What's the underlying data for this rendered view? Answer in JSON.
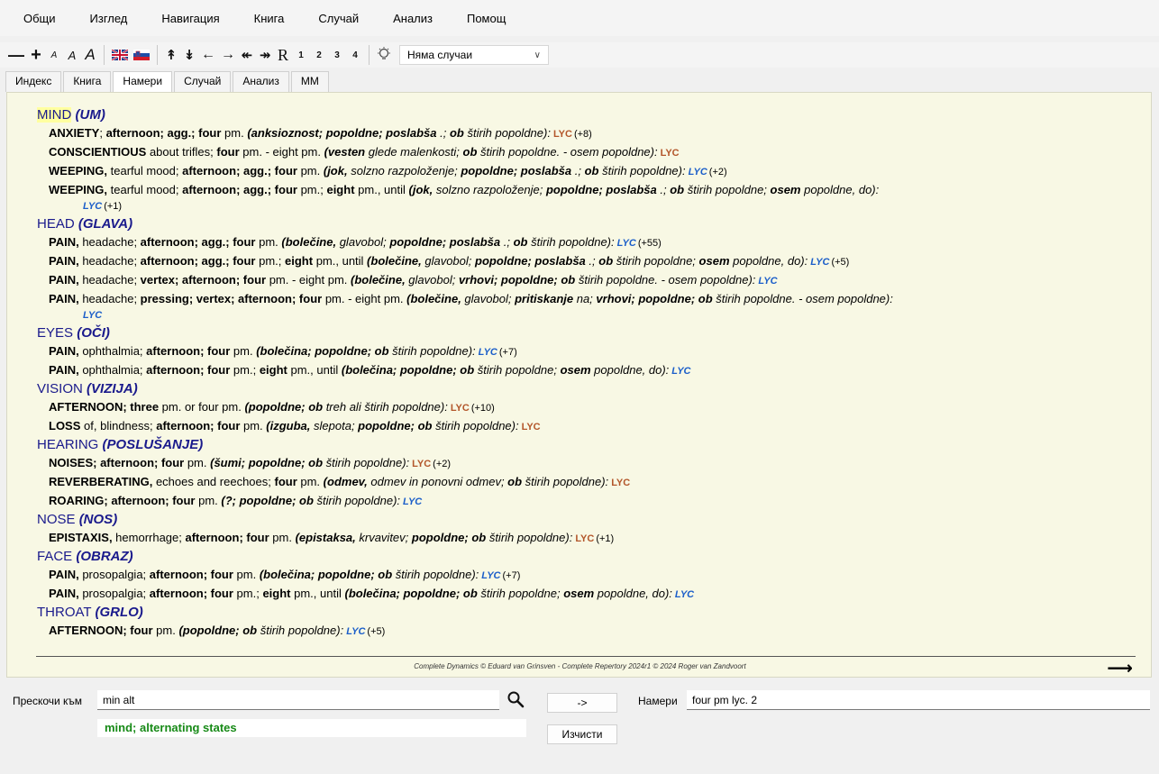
{
  "menu": [
    "Общи",
    "Изглед",
    "Навигация",
    "Книга",
    "Случай",
    "Анализ",
    "Помощ"
  ],
  "toolbar": {
    "font_small": "A",
    "font_medium": "A",
    "font_large": "A",
    "r_label": "R",
    "levels": [
      "1",
      "2",
      "3",
      "4"
    ],
    "case_select": "Няма случаи"
  },
  "tabs": [
    "Индекс",
    "Книга",
    "Намери",
    "Случай",
    "Анализ",
    "ММ"
  ],
  "active_tab": "Намери",
  "repertory": {
    "chapters": [
      {
        "name": "MIND",
        "tr": "(UM)",
        "rubrics": [
          {
            "parts": [
              [
                "b",
                "ANXIETY"
              ],
              [
                "n",
                "; "
              ],
              [
                "b",
                "afternoon; agg.; four"
              ],
              [
                "n",
                " pm. "
              ],
              [
                "bi",
                "(anksioznost; popoldne; poslabša"
              ],
              [
                "i",
                " .; "
              ],
              [
                "bi",
                "ob"
              ],
              [
                "i",
                " štirih popoldne):"
              ]
            ],
            "lyc": "LYC",
            "lyc_color": "orange",
            "count": "(+8)"
          },
          {
            "parts": [
              [
                "b",
                "CONSCIENTIOUS"
              ],
              [
                "n",
                " about trifles; "
              ],
              [
                "b",
                "four"
              ],
              [
                "n",
                " pm. - eight pm. "
              ],
              [
                "bi",
                "(vesten"
              ],
              [
                "i",
                " glede malenkosti; "
              ],
              [
                "bi",
                "ob"
              ],
              [
                "i",
                " štirih popoldne. - osem popoldne):"
              ]
            ],
            "lyc": "LYC",
            "lyc_color": "orange",
            "count": ""
          },
          {
            "parts": [
              [
                "b",
                "WEEPING,"
              ],
              [
                "n",
                " tearful mood; "
              ],
              [
                "b",
                "afternoon; agg.; four"
              ],
              [
                "n",
                " pm. "
              ],
              [
                "bi",
                "(jok,"
              ],
              [
                "i",
                " solzno razpoloženje; "
              ],
              [
                "bi",
                "popoldne; poslabša"
              ],
              [
                "i",
                " .; "
              ],
              [
                "bi",
                "ob"
              ],
              [
                "i",
                " štirih popoldne):"
              ]
            ],
            "lyc": "LYC",
            "lyc_color": "blue",
            "count": "(+2)"
          },
          {
            "parts": [
              [
                "b",
                "WEEPING,"
              ],
              [
                "n",
                " tearful mood; "
              ],
              [
                "b",
                "afternoon; agg.; four"
              ],
              [
                "n",
                " pm.; "
              ],
              [
                "b",
                "eight"
              ],
              [
                "n",
                " pm., until "
              ],
              [
                "bi",
                "(jok,"
              ],
              [
                "i",
                " solzno razpoloženje; "
              ],
              [
                "bi",
                "popoldne; poslabša"
              ],
              [
                "i",
                " .; "
              ],
              [
                "bi",
                "ob"
              ],
              [
                "i",
                " štirih popoldne; "
              ],
              [
                "bi",
                "osem"
              ],
              [
                "i",
                " popoldne, do):"
              ]
            ],
            "lyc": "LYC",
            "lyc_color": "blue",
            "count": "(+1)",
            "wrap": true
          }
        ]
      },
      {
        "name": "HEAD",
        "tr": "(GLAVA)",
        "rubrics": [
          {
            "parts": [
              [
                "b",
                "PAIN,"
              ],
              [
                "n",
                " headache; "
              ],
              [
                "b",
                "afternoon; agg.; four"
              ],
              [
                "n",
                " pm. "
              ],
              [
                "bi",
                "(bolečine,"
              ],
              [
                "i",
                " glavobol; "
              ],
              [
                "bi",
                "popoldne; poslabša"
              ],
              [
                "i",
                " .; "
              ],
              [
                "bi",
                "ob"
              ],
              [
                "i",
                " štirih popoldne):"
              ]
            ],
            "lyc": "LYC",
            "lyc_color": "blue",
            "count": "(+55)"
          },
          {
            "parts": [
              [
                "b",
                "PAIN,"
              ],
              [
                "n",
                " headache; "
              ],
              [
                "b",
                "afternoon; agg.; four"
              ],
              [
                "n",
                " pm.; "
              ],
              [
                "b",
                "eight"
              ],
              [
                "n",
                " pm., until "
              ],
              [
                "bi",
                "(bolečine,"
              ],
              [
                "i",
                " glavobol; "
              ],
              [
                "bi",
                "popoldne; poslabša"
              ],
              [
                "i",
                " .; "
              ],
              [
                "bi",
                "ob"
              ],
              [
                "i",
                " štirih popoldne; "
              ],
              [
                "bi",
                "osem"
              ],
              [
                "i",
                " popoldne, do):"
              ]
            ],
            "lyc": "LYC",
            "lyc_color": "blue",
            "count": "(+5)"
          },
          {
            "parts": [
              [
                "b",
                "PAIN,"
              ],
              [
                "n",
                " headache; "
              ],
              [
                "b",
                "vertex; afternoon; four"
              ],
              [
                "n",
                " pm. - eight pm. "
              ],
              [
                "bi",
                "(bolečine,"
              ],
              [
                "i",
                " glavobol; "
              ],
              [
                "bi",
                "vrhovi; popoldne; ob"
              ],
              [
                "i",
                " štirih popoldne. - osem popoldne):"
              ]
            ],
            "lyc": "LYC",
            "lyc_color": "blue",
            "count": ""
          },
          {
            "parts": [
              [
                "b",
                "PAIN,"
              ],
              [
                "n",
                " headache; "
              ],
              [
                "b",
                "pressing; vertex; afternoon; four"
              ],
              [
                "n",
                " pm. - eight pm. "
              ],
              [
                "bi",
                "(bolečine,"
              ],
              [
                "i",
                " glavobol; "
              ],
              [
                "bi",
                "pritiskanje"
              ],
              [
                "i",
                " na; "
              ],
              [
                "bi",
                "vrhovi; popoldne; ob"
              ],
              [
                "i",
                " štirih popoldne. - osem popoldne):"
              ]
            ],
            "lyc": "LYC",
            "lyc_color": "blue",
            "count": "",
            "wrap": true
          }
        ]
      },
      {
        "name": "EYES",
        "tr": "(OČI)",
        "rubrics": [
          {
            "parts": [
              [
                "b",
                "PAIN,"
              ],
              [
                "n",
                " ophthalmia; "
              ],
              [
                "b",
                "afternoon; four"
              ],
              [
                "n",
                " pm. "
              ],
              [
                "bi",
                "(bolečina; popoldne; ob"
              ],
              [
                "i",
                " štirih popoldne):"
              ]
            ],
            "lyc": "LYC",
            "lyc_color": "blue",
            "count": "(+7)"
          },
          {
            "parts": [
              [
                "b",
                "PAIN,"
              ],
              [
                "n",
                " ophthalmia; "
              ],
              [
                "b",
                "afternoon; four"
              ],
              [
                "n",
                " pm.; "
              ],
              [
                "b",
                "eight"
              ],
              [
                "n",
                " pm., until "
              ],
              [
                "bi",
                "(bolečina; popoldne; ob"
              ],
              [
                "i",
                " štirih popoldne; "
              ],
              [
                "bi",
                "osem"
              ],
              [
                "i",
                " popoldne, do):"
              ]
            ],
            "lyc": "LYC",
            "lyc_color": "blue",
            "count": ""
          }
        ]
      },
      {
        "name": "VISION",
        "tr": "(VIZIJA)",
        "rubrics": [
          {
            "parts": [
              [
                "b",
                "AFTERNOON; three"
              ],
              [
                "n",
                " pm. or four pm. "
              ],
              [
                "bi",
                "(popoldne; ob"
              ],
              [
                "i",
                " treh ali štirih popoldne):"
              ]
            ],
            "lyc": "LYC",
            "lyc_color": "orange",
            "count": "(+10)"
          },
          {
            "parts": [
              [
                "b",
                "LOSS"
              ],
              [
                "n",
                " of, blindness; "
              ],
              [
                "b",
                "afternoon; four"
              ],
              [
                "n",
                " pm. "
              ],
              [
                "bi",
                "(izguba,"
              ],
              [
                "i",
                " slepota; "
              ],
              [
                "bi",
                "popoldne; ob"
              ],
              [
                "i",
                " štirih popoldne):"
              ]
            ],
            "lyc": "LYC",
            "lyc_color": "orange",
            "count": ""
          }
        ]
      },
      {
        "name": "HEARING",
        "tr": "(POSLUŠANJE)",
        "rubrics": [
          {
            "parts": [
              [
                "b",
                "NOISES; afternoon; four"
              ],
              [
                "n",
                " pm. "
              ],
              [
                "bi",
                "(šumi; popoldne; ob"
              ],
              [
                "i",
                " štirih popoldne):"
              ]
            ],
            "lyc": "LYC",
            "lyc_color": "orange",
            "count": "(+2)"
          },
          {
            "parts": [
              [
                "b",
                "REVERBERATING,"
              ],
              [
                "n",
                " echoes and reechoes; "
              ],
              [
                "b",
                "four"
              ],
              [
                "n",
                " pm. "
              ],
              [
                "bi",
                "(odmev,"
              ],
              [
                "i",
                " odmev in ponovni odmev; "
              ],
              [
                "bi",
                "ob"
              ],
              [
                "i",
                " štirih popoldne):"
              ]
            ],
            "lyc": "LYC",
            "lyc_color": "orange",
            "count": ""
          },
          {
            "parts": [
              [
                "b",
                "ROARING; afternoon; four"
              ],
              [
                "n",
                " pm. "
              ],
              [
                "bi",
                "(?; popoldne; ob"
              ],
              [
                "i",
                " štirih popoldne):"
              ]
            ],
            "lyc": "LYC",
            "lyc_color": "blue",
            "count": ""
          }
        ]
      },
      {
        "name": "NOSE",
        "tr": "(NOS)",
        "rubrics": [
          {
            "parts": [
              [
                "b",
                "EPISTAXIS,"
              ],
              [
                "n",
                " hemorrhage; "
              ],
              [
                "b",
                "afternoon; four"
              ],
              [
                "n",
                " pm. "
              ],
              [
                "bi",
                "(epistaksa,"
              ],
              [
                "i",
                " krvavitev; "
              ],
              [
                "bi",
                "popoldne; ob"
              ],
              [
                "i",
                " štirih popoldne):"
              ]
            ],
            "lyc": "LYC",
            "lyc_color": "orange",
            "count": "(+1)"
          }
        ]
      },
      {
        "name": "FACE",
        "tr": "(OBRAZ)",
        "rubrics": [
          {
            "parts": [
              [
                "b",
                "PAIN,"
              ],
              [
                "n",
                " prosopalgia; "
              ],
              [
                "b",
                "afternoon; four"
              ],
              [
                "n",
                " pm. "
              ],
              [
                "bi",
                "(bolečina; popoldne; ob"
              ],
              [
                "i",
                " štirih popoldne):"
              ]
            ],
            "lyc": "LYC",
            "lyc_color": "blue",
            "count": "(+7)"
          },
          {
            "parts": [
              [
                "b",
                "PAIN,"
              ],
              [
                "n",
                " prosopalgia; "
              ],
              [
                "b",
                "afternoon; four"
              ],
              [
                "n",
                " pm.; "
              ],
              [
                "b",
                "eight"
              ],
              [
                "n",
                " pm., until "
              ],
              [
                "bi",
                "(bolečina; popoldne; ob"
              ],
              [
                "i",
                " štirih popoldne; "
              ],
              [
                "bi",
                "osem"
              ],
              [
                "i",
                " popoldne, do):"
              ]
            ],
            "lyc": "LYC",
            "lyc_color": "blue",
            "count": ""
          }
        ]
      },
      {
        "name": "THROAT",
        "tr": "(GRLO)",
        "rubrics": [
          {
            "parts": [
              [
                "b",
                "AFTERNOON; four"
              ],
              [
                "n",
                " pm. "
              ],
              [
                "bi",
                "(popoldne; ob"
              ],
              [
                "i",
                " štirih popoldne):"
              ]
            ],
            "lyc": "LYC",
            "lyc_color": "blue",
            "count": "(+5)"
          }
        ]
      }
    ],
    "copyright": "Complete Dynamics © Eduard van Grinsven  -  Complete Repertory 2024r1 © 2024 Roger van Zandvoort"
  },
  "bottom": {
    "jump_label": "Прескочи към",
    "jump_value": "min alt",
    "suggestion": "mind; alternating states",
    "go_button": "->",
    "find_label": "Намери",
    "find_value": "four pm lyc. 2",
    "clear_button": "Изчисти"
  },
  "colors": {
    "content_bg": "#f8f8e4",
    "chapter": "#1a1a8c",
    "lyc_orange": "#b3562a",
    "lyc_blue": "#1b5ec9",
    "suggestion": "#178a17"
  }
}
